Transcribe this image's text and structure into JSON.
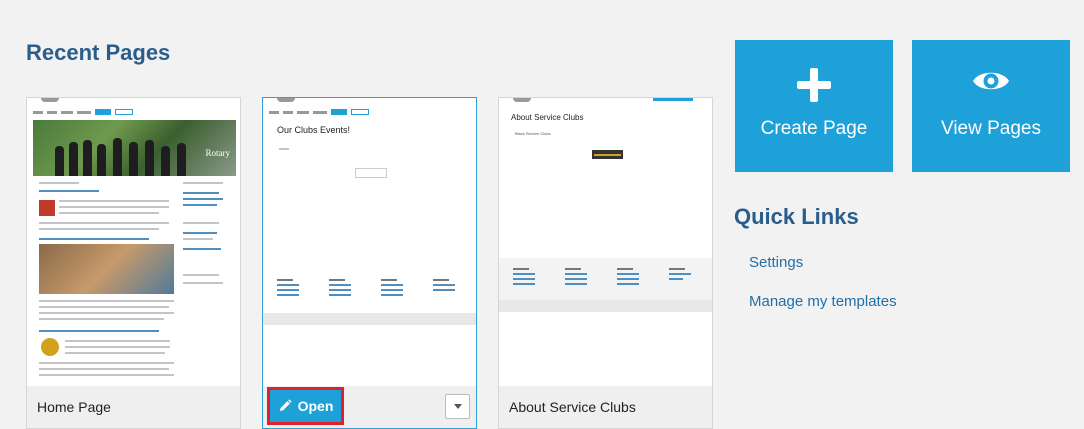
{
  "recent": {
    "title": "Recent Pages",
    "cards": [
      {
        "label": "Home Page",
        "hero_text": "Rotary"
      },
      {
        "label": "",
        "heading": "Our Clubs Events!"
      },
      {
        "label": "About Service Clubs",
        "heading": "About Service Clubs",
        "sub": "Black Service Clubs"
      }
    ],
    "open_label": "Open"
  },
  "tiles": {
    "create_label": "Create Page",
    "view_label": "View Pages"
  },
  "quick_links": {
    "title": "Quick Links",
    "items": [
      "Settings",
      "Manage my templates"
    ]
  },
  "colors": {
    "accent": "#1ea0d8",
    "heading": "#2a5d8c",
    "link": "#1f6fa8",
    "highlight": "#e0202b"
  },
  "icons": {
    "create": "plus-icon",
    "view": "eye-icon",
    "open": "pencil-icon",
    "dropdown": "chevron-down-icon"
  }
}
